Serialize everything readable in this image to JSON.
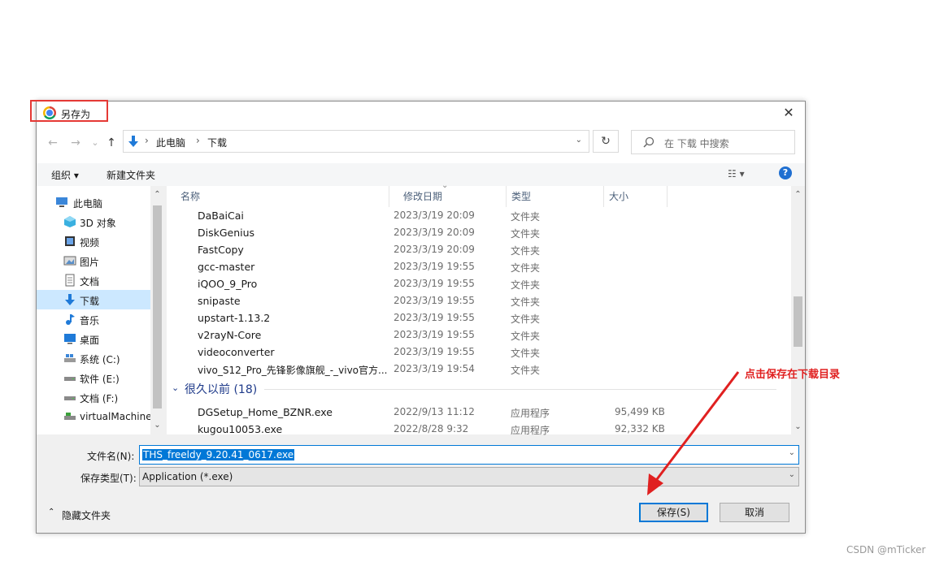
{
  "window": {
    "title": "另存为"
  },
  "nav": {
    "back": "←",
    "forward": "→",
    "recent": "⌄",
    "up": "↑",
    "breadcrumb": [
      "此电脑",
      "下载"
    ],
    "separator": "›",
    "refresh": "↻",
    "search_placeholder": "在 下载 中搜索"
  },
  "toolbar": {
    "organize": "组织 ▾",
    "new_folder": "新建文件夹",
    "help": "?"
  },
  "sidebar": {
    "items": [
      {
        "label": "此电脑",
        "icon": "computer-icon"
      },
      {
        "label": "3D 对象",
        "icon": "cube-icon"
      },
      {
        "label": "视频",
        "icon": "video-icon"
      },
      {
        "label": "图片",
        "icon": "picture-icon"
      },
      {
        "label": "文档",
        "icon": "document-icon"
      },
      {
        "label": "下载",
        "icon": "download-icon"
      },
      {
        "label": "音乐",
        "icon": "music-icon"
      },
      {
        "label": "桌面",
        "icon": "desktop-icon"
      },
      {
        "label": "系统 (C:)",
        "icon": "drive-icon"
      },
      {
        "label": "软件 (E:)",
        "icon": "drive-icon"
      },
      {
        "label": "文档 (F:)",
        "icon": "drive-icon"
      },
      {
        "label": "virtualMachine",
        "icon": "drive-icon"
      }
    ],
    "selected": "下载"
  },
  "columns": {
    "name": "名称",
    "date": "修改日期",
    "type": "类型",
    "size": "大小"
  },
  "files": [
    {
      "name": "DaBaiCai",
      "date": "2023/3/19 20:09",
      "type": "文件夹",
      "size": ""
    },
    {
      "name": "DiskGenius",
      "date": "2023/3/19 20:09",
      "type": "文件夹",
      "size": ""
    },
    {
      "name": "FastCopy",
      "date": "2023/3/19 20:09",
      "type": "文件夹",
      "size": ""
    },
    {
      "name": "gcc-master",
      "date": "2023/3/19 19:55",
      "type": "文件夹",
      "size": ""
    },
    {
      "name": "iQOO_9_Pro",
      "date": "2023/3/19 19:55",
      "type": "文件夹",
      "size": ""
    },
    {
      "name": "snipaste",
      "date": "2023/3/19 19:55",
      "type": "文件夹",
      "size": ""
    },
    {
      "name": "upstart-1.13.2",
      "date": "2023/3/19 19:55",
      "type": "文件夹",
      "size": ""
    },
    {
      "name": "v2rayN-Core",
      "date": "2023/3/19 19:55",
      "type": "文件夹",
      "size": ""
    },
    {
      "name": "videoconverter",
      "date": "2023/3/19 19:55",
      "type": "文件夹",
      "size": ""
    },
    {
      "name": "vivo_S12_Pro_先锋影像旗舰_-_vivo官方...",
      "date": "2023/3/19 19:54",
      "type": "文件夹",
      "size": ""
    }
  ],
  "group": {
    "label": "很久以前 (18)"
  },
  "old_files": [
    {
      "name": "DGSetup_Home_BZNR.exe",
      "date": "2022/9/13 11:12",
      "type": "应用程序",
      "size": "95,499 KB"
    },
    {
      "name": "kugou10053.exe",
      "date": "2022/8/28 9:32",
      "type": "应用程序",
      "size": "92,332 KB"
    }
  ],
  "form": {
    "filename_label": "文件名(N):",
    "filename_value": "THS_freeldy_9.20.41_0617.exe",
    "filetype_label": "保存类型(T):",
    "filetype_value": "Application (*.exe)"
  },
  "footer": {
    "hide_folders": "隐藏文件夹",
    "save": "保存(S)",
    "cancel": "取消"
  },
  "annotation": {
    "text": "点击保存在下载目录",
    "color": "#e02020"
  },
  "watermark": "CSDN @mTicker"
}
